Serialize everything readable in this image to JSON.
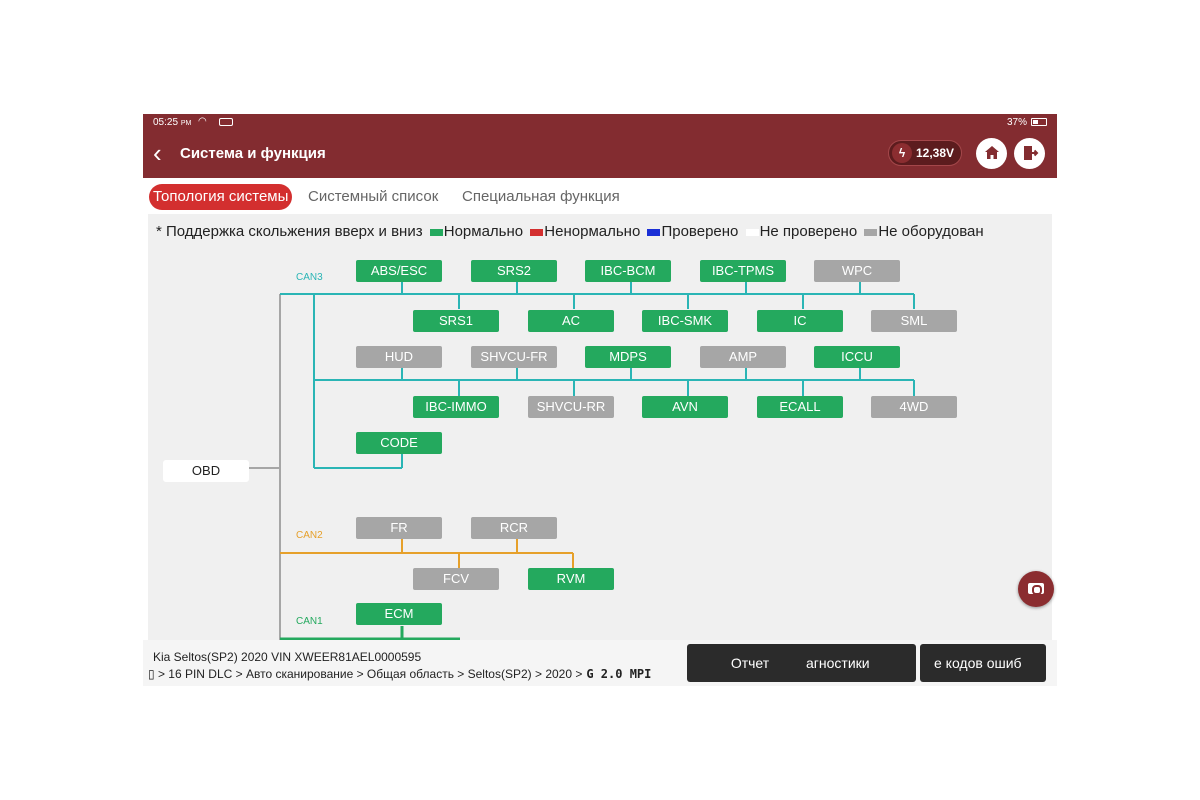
{
  "status_bar": {
    "time": "05:25",
    "ampm": "PM",
    "battery": "37%"
  },
  "header": {
    "title": "Система и функция",
    "voltage": "12,38V"
  },
  "tabs": [
    {
      "label": "Топология системы",
      "active": true
    },
    {
      "label": "Системный список",
      "active": false
    },
    {
      "label": "Специальная функция",
      "active": false
    }
  ],
  "legend": {
    "note": "* Поддержка скольжения вверх и вниз",
    "items": [
      {
        "label": "Нормально",
        "color": "#24a95e"
      },
      {
        "label": "Ненормально",
        "color": "#d32f2f"
      },
      {
        "label": "Проверено",
        "color": "#1a2fd6"
      },
      {
        "label": "Не проверено",
        "color": "#ffffff"
      },
      {
        "label": "Не оборудован",
        "color": "#a6a6a6"
      }
    ]
  },
  "topology": {
    "root": "OBD",
    "buses": [
      {
        "name": "CAN3",
        "color": "#2ab5b5"
      },
      {
        "name": "CAN2",
        "color": "#e6a02a"
      },
      {
        "name": "CAN1",
        "color": "#24a95e"
      }
    ],
    "modules": [
      {
        "label": "ABS/ESC",
        "status": "normal"
      },
      {
        "label": "SRS2",
        "status": "normal"
      },
      {
        "label": "IBC-BCM",
        "status": "normal"
      },
      {
        "label": "IBC-TPMS",
        "status": "normal"
      },
      {
        "label": "WPC",
        "status": "not_equipped"
      },
      {
        "label": "SRS1",
        "status": "normal"
      },
      {
        "label": "AC",
        "status": "normal"
      },
      {
        "label": "IBC-SMK",
        "status": "normal"
      },
      {
        "label": "IC",
        "status": "normal"
      },
      {
        "label": "SML",
        "status": "not_equipped"
      },
      {
        "label": "HUD",
        "status": "not_equipped"
      },
      {
        "label": "SHVCU-FR",
        "status": "not_equipped"
      },
      {
        "label": "MDPS",
        "status": "normal"
      },
      {
        "label": "AMP",
        "status": "not_equipped"
      },
      {
        "label": "ICCU",
        "status": "normal"
      },
      {
        "label": "IBC-IMMO",
        "status": "normal"
      },
      {
        "label": "SHVCU-RR",
        "status": "not_equipped"
      },
      {
        "label": "AVN",
        "status": "normal"
      },
      {
        "label": "ECALL",
        "status": "normal"
      },
      {
        "label": "4WD",
        "status": "not_equipped"
      },
      {
        "label": "CODE",
        "status": "normal"
      },
      {
        "label": "FR",
        "status": "not_equipped"
      },
      {
        "label": "RCR",
        "status": "not_equipped"
      },
      {
        "label": "FCV",
        "status": "not_equipped"
      },
      {
        "label": "RVM",
        "status": "normal"
      },
      {
        "label": "ECM",
        "status": "normal"
      }
    ]
  },
  "bottom": {
    "vehicle": "Kia   Seltos(SP2)   2020   VIN   XWEER81AEL0000595",
    "path": "▯ > 16 PIN DLC > Авто сканирование > Общая область > Seltos(SP2) > 2020 >",
    "engine": "G 2.0 MPI",
    "buttons": [
      "Отчет",
      "агностики",
      "е кодов ошиб"
    ]
  }
}
